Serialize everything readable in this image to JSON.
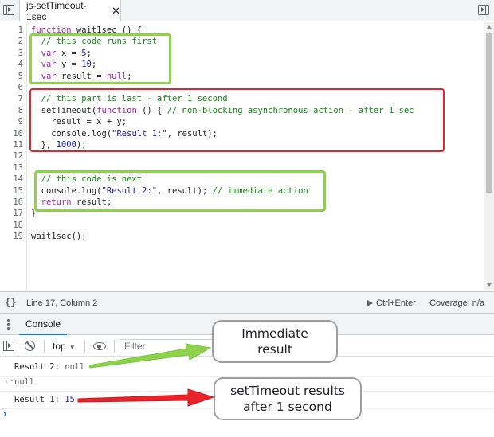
{
  "tabbar": {
    "file_tab_label": "js-setTimeout-1sec",
    "close_glyph": "✕"
  },
  "editor": {
    "lines": [
      {
        "num": "1"
      },
      {
        "num": "2"
      },
      {
        "num": "3"
      },
      {
        "num": "4"
      },
      {
        "num": "5"
      },
      {
        "num": "6"
      },
      {
        "num": "7"
      },
      {
        "num": "8"
      },
      {
        "num": "9"
      },
      {
        "num": "10"
      },
      {
        "num": "11"
      },
      {
        "num": "12"
      },
      {
        "num": "13"
      },
      {
        "num": "14"
      },
      {
        "num": "15"
      },
      {
        "num": "16"
      },
      {
        "num": "17"
      },
      {
        "num": "18"
      },
      {
        "num": "19"
      }
    ],
    "code": {
      "l1a": "function",
      "l1b": " wait1sec () {",
      "l2": "  // this code runs first",
      "l3a": "  ",
      "l3b": "var",
      "l3c": " x = ",
      "l3d": "5",
      "l3e": ";",
      "l4a": "  ",
      "l4b": "var",
      "l4c": " y = ",
      "l4d": "10",
      "l4e": ";",
      "l5a": "  ",
      "l5b": "var",
      "l5c": " result = ",
      "l5d": "null",
      "l5e": ";",
      "l7": "  // this part is last - after 1 second",
      "l8a": "  setTimeout(",
      "l8b": "function",
      "l8c": " () { ",
      "l8d": "// non-blocking asynchronous action - after 1 sec",
      "l9": "    result = x + y;",
      "l10a": "    console.log(",
      "l10b": "\"Result 1:\"",
      "l10c": ", result);",
      "l11a": "  }, ",
      "l11b": "1000",
      "l11c": ");",
      "l14": "  // this code is next",
      "l15a": "  console.log(",
      "l15b": "\"Result 2:\"",
      "l15c": ", result); ",
      "l15d": "// immediate action",
      "l16a": "  ",
      "l16b": "return",
      "l16c": " result;",
      "l17": "}",
      "l19": "wait1sec();"
    }
  },
  "statusbar": {
    "braces_glyph": "{}",
    "cursor_position": "Line 17, Column 2",
    "run_shortcut": "Ctrl+Enter",
    "coverage": "Coverage: n/a"
  },
  "drawer": {
    "console_tab": "Console"
  },
  "console_toolbar": {
    "context": "top",
    "caret": "▼",
    "filter_placeholder": "Filter"
  },
  "console_messages": {
    "m1_label": "Result 2: ",
    "m1_value": "null",
    "m2_arrow": "‹·",
    "m2_value": "null",
    "m3_label": "Result 1: ",
    "m3_value": "15",
    "prompt": "›"
  },
  "annotations": {
    "callout1_line1": "Immediate",
    "callout1_line2": "result",
    "callout2_line1": "setTimeout results",
    "callout2_line2": "after 1 second",
    "green": "#8ed24b",
    "red": "#e8232a"
  }
}
